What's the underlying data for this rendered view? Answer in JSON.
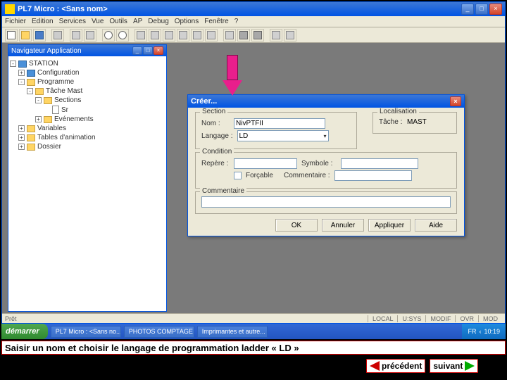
{
  "main_window": {
    "title": "PL7 Micro : <Sans nom>",
    "menus": [
      "Fichier",
      "Edition",
      "Services",
      "Vue",
      "Outils",
      "AP",
      "Debug",
      "Options",
      "Fenêtre",
      "?"
    ]
  },
  "navigator": {
    "title": "Navigateur Application",
    "tree": {
      "root": "STATION",
      "items": [
        {
          "label": "Configuration",
          "indent": 1,
          "icon": "monitor",
          "toggle": "+"
        },
        {
          "label": "Programme",
          "indent": 1,
          "icon": "folder",
          "toggle": "-"
        },
        {
          "label": "Tâche Mast",
          "indent": 2,
          "icon": "folder",
          "toggle": "-"
        },
        {
          "label": "Sections",
          "indent": 3,
          "icon": "folder",
          "toggle": "-"
        },
        {
          "label": "Sr",
          "indent": 4,
          "icon": "page",
          "toggle": ""
        },
        {
          "label": "Evénements",
          "indent": 3,
          "icon": "folder",
          "toggle": "+"
        },
        {
          "label": "Variables",
          "indent": 1,
          "icon": "folder",
          "toggle": "+"
        },
        {
          "label": "Tables d'animation",
          "indent": 1,
          "icon": "folder",
          "toggle": "+"
        },
        {
          "label": "Dossier",
          "indent": 1,
          "icon": "folder",
          "toggle": "+"
        }
      ]
    }
  },
  "dialog": {
    "title": "Créer...",
    "section_legend": "Section",
    "nom_label": "Nom :",
    "nom_value": "NivPTFII",
    "langage_label": "Langage :",
    "langage_value": "LD",
    "loc_legend": "Localisation",
    "tache_label": "Tâche :",
    "tache_value": "MAST",
    "condition_legend": "Condition",
    "repere_label": "Repère :",
    "symbole_label": "Symbole :",
    "forcable_label": "Forçable",
    "commentaire_label": "Commentaire :",
    "comment_legend": "Commentaire",
    "buttons": {
      "ok": "OK",
      "annuler": "Annuler",
      "appliquer": "Appliquer",
      "aide": "Aide"
    }
  },
  "statusbar": {
    "left": "Prêt",
    "mode1": "LOCAL",
    "mode2": "U:SYS",
    "mode3": "MODIF",
    "ovr": "OVR",
    "mod": "MOD"
  },
  "taskbar": {
    "start": "démarrer",
    "items": [
      "PL7 Micro : <Sans no...",
      "PHOTOS COMPTAGE ...",
      "Imprimantes et autre..."
    ],
    "tray_lang": "FR",
    "tray_time": "10:19"
  },
  "caption": "Saisir un nom et choisir le langage de programmation ladder « LD »",
  "nav": {
    "prev": "précédent",
    "next": "suivant"
  }
}
